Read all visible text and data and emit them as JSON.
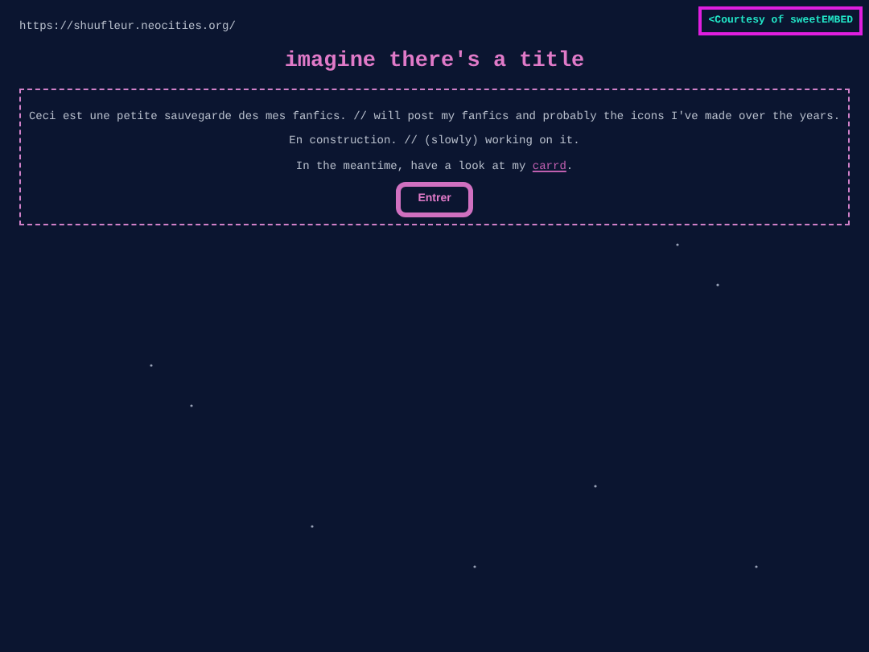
{
  "url": "https://shuufleur.neocities.org/",
  "badge": "<Courtesy of sweetEMBED",
  "title": "imagine there's a title",
  "lines": [
    {
      "text": "Ceci est une petite sauvegarde des mes fanfics. // will post my fanfics and probably the icons I've made over the years."
    },
    {
      "text": "En construction. // (slowly) working on it."
    },
    {
      "text": "In the meantime, have a look at my ",
      "link": "carrd",
      "after": "."
    }
  ],
  "button": "Entrer"
}
